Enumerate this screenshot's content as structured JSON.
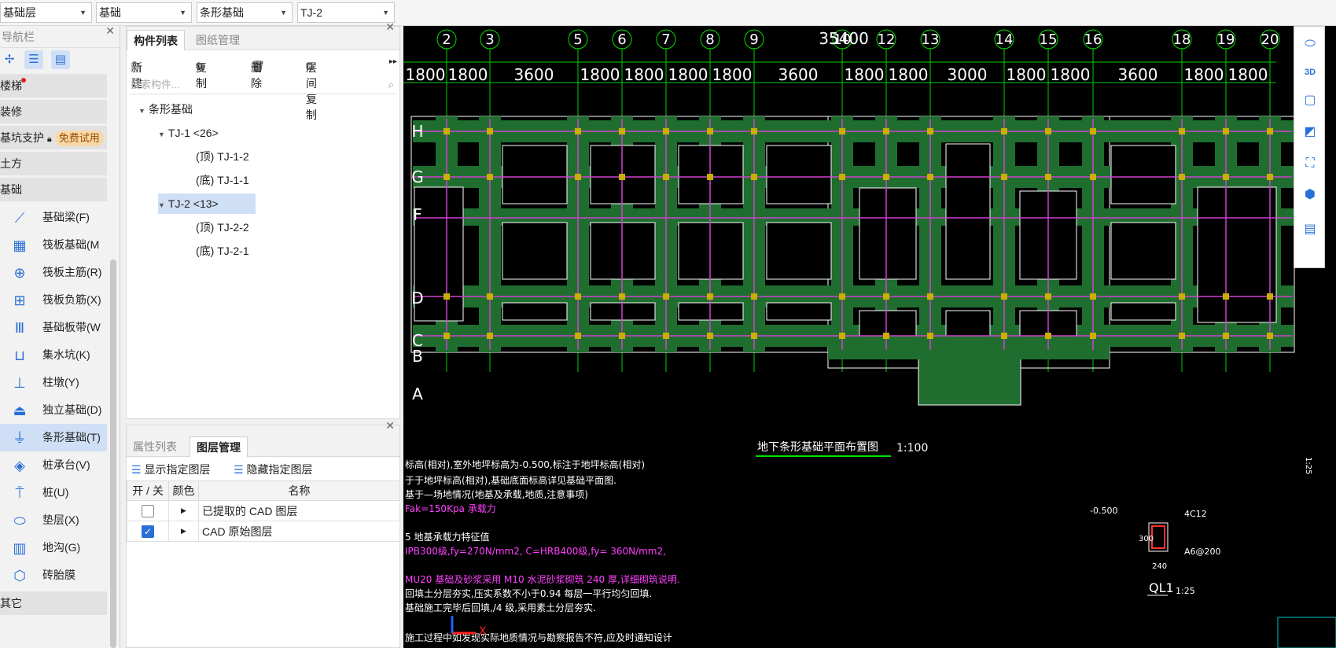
{
  "toolbar": {
    "floor": "基础层",
    "category": "基础",
    "type": "条形基础",
    "element": "TJ-2"
  },
  "nav": {
    "title": "导航栏",
    "categories_top": [
      {
        "label": "楼梯",
        "dot": true
      },
      {
        "label": "装修"
      },
      {
        "label": "基坑支护",
        "lock": true,
        "badge": "免费试用"
      },
      {
        "label": "土方"
      },
      {
        "label": "基础"
      }
    ],
    "items": [
      {
        "label": "基础梁(F)",
        "icon": "foundation-beam-icon"
      },
      {
        "label": "筏板基础(M",
        "icon": "raft-foundation-icon"
      },
      {
        "label": "筏板主筋(R)",
        "icon": "raft-main-rebar-icon"
      },
      {
        "label": "筏板负筋(X)",
        "icon": "raft-negative-rebar-icon"
      },
      {
        "label": "基础板带(W",
        "icon": "foundation-strip-icon"
      },
      {
        "label": "集水坑(K)",
        "icon": "sump-pit-icon"
      },
      {
        "label": "柱墩(Y)",
        "icon": "column-pier-icon"
      },
      {
        "label": "独立基础(D)",
        "icon": "isolated-foundation-icon"
      },
      {
        "label": "条形基础(T)",
        "icon": "strip-foundation-icon",
        "active": true
      },
      {
        "label": "桩承台(V)",
        "icon": "pile-cap-icon"
      },
      {
        "label": "桩(U)",
        "icon": "pile-icon"
      },
      {
        "label": "垫层(X)",
        "icon": "cushion-icon"
      },
      {
        "label": "地沟(G)",
        "icon": "trench-icon"
      },
      {
        "label": "砖胎膜",
        "icon": "brick-form-icon"
      }
    ],
    "other": "其它"
  },
  "complist": {
    "tabs": [
      "构件列表",
      "图纸管理"
    ],
    "actions": {
      "new": "新建",
      "copy": "复制",
      "delete": "删除",
      "floor_copy": "层间复制"
    },
    "search_placeholder": "搜索构件...",
    "tree": {
      "root": "条形基础",
      "groups": [
        {
          "label": "TJ-1 <26>",
          "children": [
            "(顶)  TJ-1-2",
            "(底)  TJ-1-1"
          ]
        },
        {
          "label": "TJ-2 <13>",
          "children": [
            "(顶)  TJ-2-2",
            "(底)  TJ-2-1"
          ]
        }
      ]
    }
  },
  "layers": {
    "tabs": [
      "属性列表",
      "图层管理"
    ],
    "show_label": "显示指定图层",
    "hide_label": "隐藏指定图层",
    "headers": [
      "开 / 关",
      "颜色",
      "名称"
    ],
    "rows": [
      {
        "checked": false,
        "name": "已提取的 CAD 图层"
      },
      {
        "checked": true,
        "name": "CAD 原始图层"
      }
    ]
  },
  "cad": {
    "axis_numbers": [
      "2",
      "3",
      "5",
      "6",
      "7",
      "8",
      "9",
      "10",
      "12",
      "13",
      "14",
      "15",
      "16",
      "18",
      "19",
      "20"
    ],
    "total_dim": "35400",
    "dims": [
      "1800",
      "1800",
      "3600",
      "1800",
      "1800",
      "1800",
      "1800",
      "3600",
      "1800",
      "1800",
      "3000",
      "1800",
      "1800",
      "3600",
      "1800",
      "1800"
    ],
    "axis_letters": [
      "H",
      "G",
      "F",
      "D",
      "C",
      "B",
      "A"
    ],
    "plan_title": "地下条形基础平面布置图",
    "plan_scale": "1:100",
    "notes": [
      "标高(相对),室外地坪标高为-0.500,标注于地坪标高(相对)",
      "于于地坪标高(相对),基础底面标高详见基础平面图.",
      "基于—场地情况(地基及承载,地质,注意事项)",
      "Fak=150Kpa 承载力",
      "5 地基承载力特征值",
      "IPB300级,fy=270N/mm2, C=HRB400级,fy= 360N/mm2,",
      "MU20 基础及砂浆采用 M10 水泥砂浆砌筑 240 厚,详细砌筑说明.",
      "回填土分层夯实,压实系数不小于0.94 每层一平行均匀回填.",
      "基础施工完毕后回填,/4 级,采用素土分层夯实.",
      "施工过程中如发现实际地质情况与勘察报告不符,应及时通知设计"
    ],
    "detail": {
      "elev": "-0.500",
      "top_rebar": "4C12",
      "stirrup": "A6@200",
      "height": "300",
      "width": "240",
      "label": "QL1",
      "scale": "1:25"
    },
    "side_label": "1:25"
  },
  "colors": {
    "accent": "#2a6fd6",
    "cad_green": "#1f6e2f",
    "cad_line": "#00e000",
    "cad_magenta": "#d040d0"
  }
}
